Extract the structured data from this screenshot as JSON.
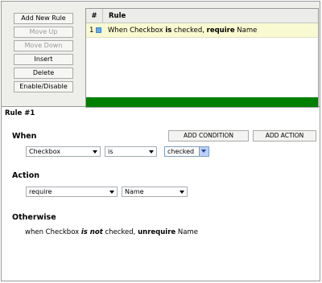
{
  "sidebar": {
    "buttons": [
      {
        "label": "Add New Rule"
      },
      {
        "label": "Move Up"
      },
      {
        "label": "Move Down"
      },
      {
        "label": "Insert"
      },
      {
        "label": "Delete"
      },
      {
        "label": "Enable/Disable"
      }
    ]
  },
  "grid": {
    "col_num": "#",
    "col_rule": "Rule",
    "rows": [
      {
        "num": "1",
        "pre": "When Checkbox ",
        "is": "is",
        "mid": " checked, ",
        "req": "require",
        "post": " Name"
      }
    ],
    "bar_color": "#008000"
  },
  "rule_title": "Rule #1",
  "when": {
    "label": "When",
    "field": "Checkbox",
    "operator": "is",
    "value": "checked",
    "add_condition": "ADD CONDITION",
    "add_action": "ADD ACTION"
  },
  "action": {
    "label": "Action",
    "verb": "require",
    "target": "Name"
  },
  "otherwise": {
    "label": "Otherwise",
    "pre": "when Checkbox ",
    "is_not": "is not",
    "mid": " checked, ",
    "unreq": "unrequire",
    "post": " Name"
  }
}
